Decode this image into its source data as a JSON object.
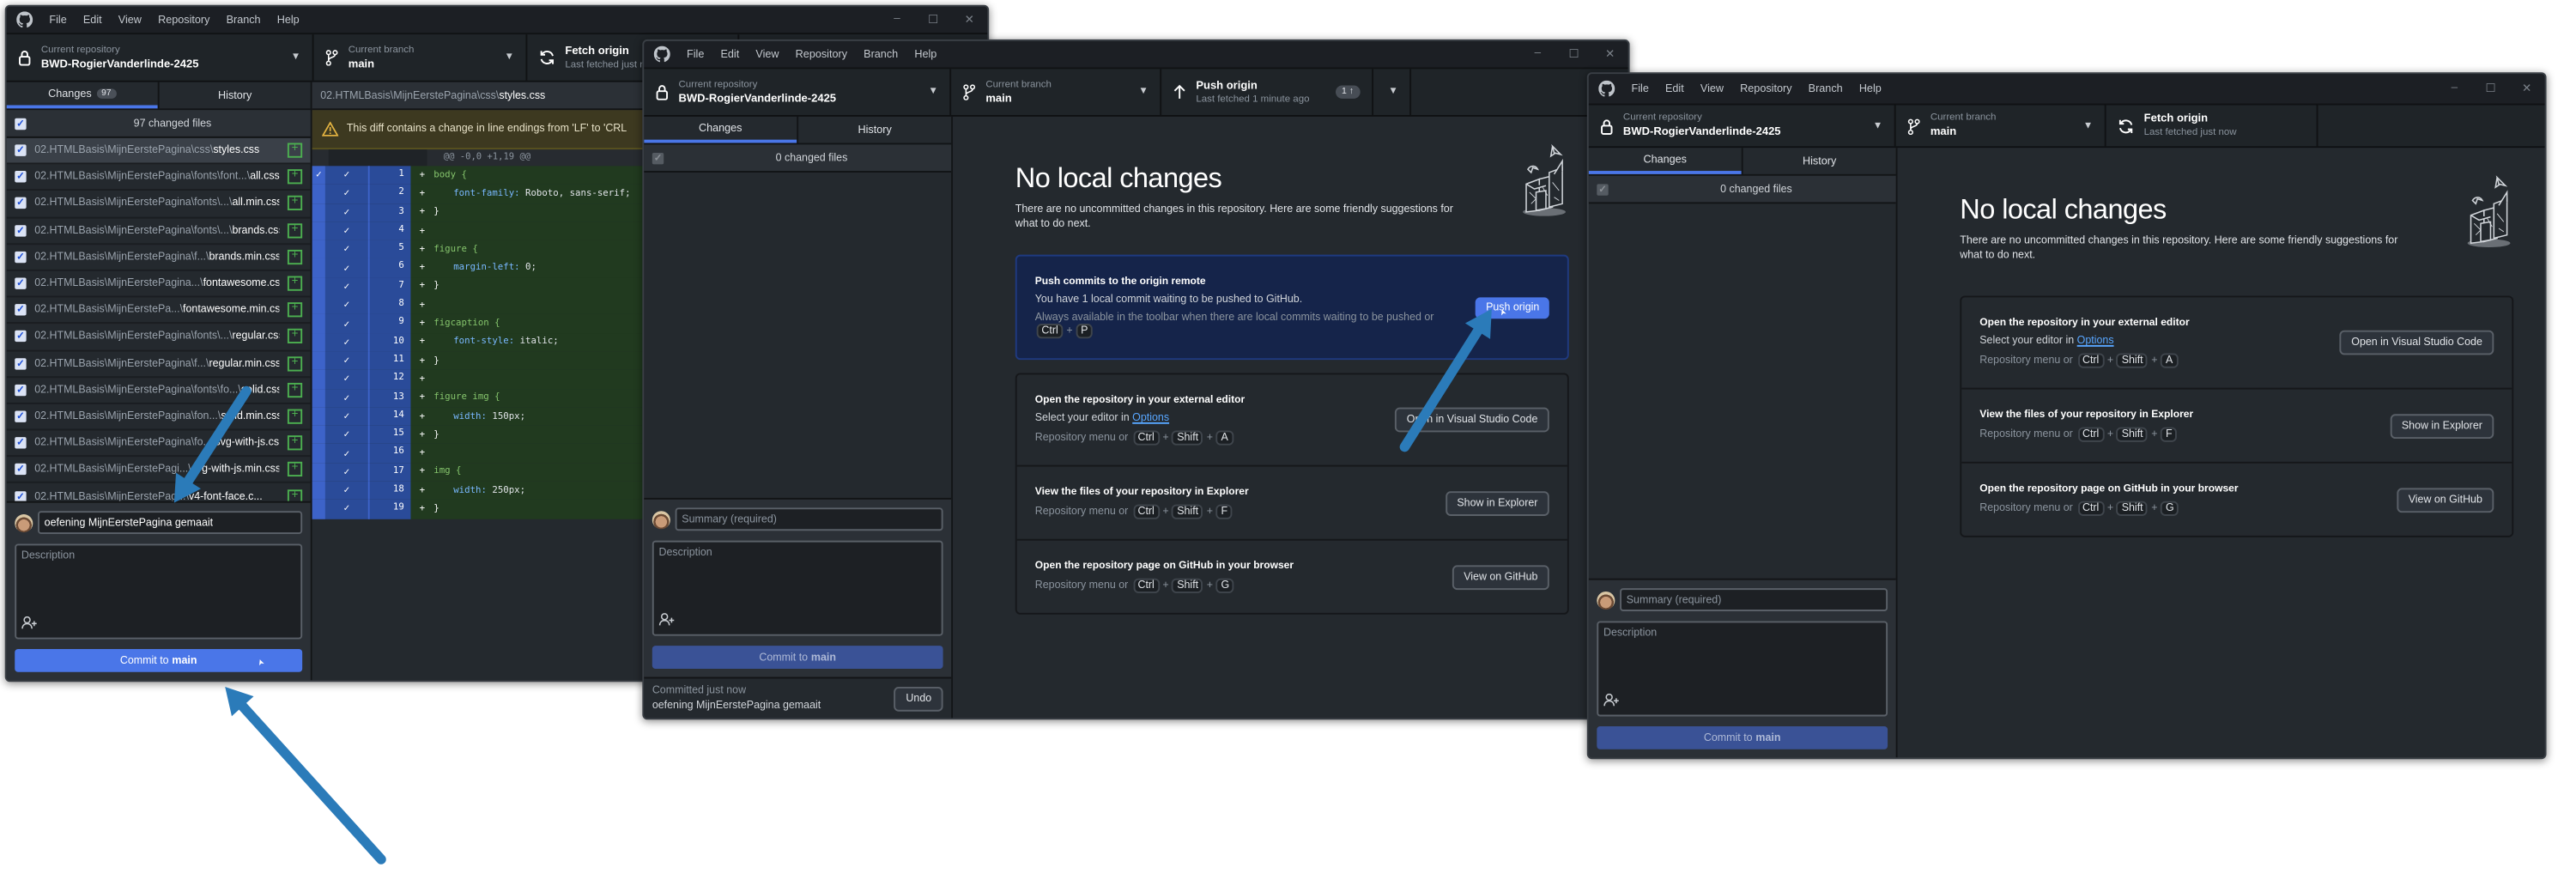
{
  "menu": [
    "File",
    "Edit",
    "View",
    "Repository",
    "Branch",
    "Help"
  ],
  "window_controls": [
    "–",
    "☐",
    "✕"
  ],
  "key_sep": "+",
  "windows": [
    {
      "repo": {
        "label": "Current repository",
        "name": "BWD-RogierVanderlinde-2425"
      },
      "branch": {
        "label": "Current branch",
        "name": "main"
      },
      "action": {
        "title": "Fetch origin",
        "subtitle": "Last fetched just now",
        "icon": "sync-icon"
      },
      "tabs": {
        "changes": "Changes",
        "changes_count": "97",
        "history": "History"
      },
      "changed_files_label": "97 changed files",
      "files": [
        {
          "dir": "02.HTMLBasis\\MijnEerstePagina\\css\\",
          "name": "styles.css"
        },
        {
          "dir": "02.HTMLBasis\\MijnEerstePagina\\fonts\\font...\\",
          "name": "all.css"
        },
        {
          "dir": "02.HTMLBasis\\MijnEerstePagina\\fonts\\...\\",
          "name": "all.min.css"
        },
        {
          "dir": "02.HTMLBasis\\MijnEerstePagina\\fonts\\...\\",
          "name": "brands.css"
        },
        {
          "dir": "02.HTMLBasis\\MijnEerstePagina\\f...\\",
          "name": "brands.min.css"
        },
        {
          "dir": "02.HTMLBasis\\MijnEerstePagina...\\",
          "name": "fontawesome.css"
        },
        {
          "dir": "02.HTMLBasis\\MijnEerstePa...\\",
          "name": "fontawesome.min.css"
        },
        {
          "dir": "02.HTMLBasis\\MijnEerstePagina\\fonts\\...\\",
          "name": "regular.css"
        },
        {
          "dir": "02.HTMLBasis\\MijnEerstePagina\\f...\\",
          "name": "regular.min.css"
        },
        {
          "dir": "02.HTMLBasis\\MijnEerstePagina\\fonts\\fo...\\",
          "name": "solid.css"
        },
        {
          "dir": "02.HTMLBasis\\MijnEerstePagina\\fon...\\",
          "name": "solid.min.css"
        },
        {
          "dir": "02.HTMLBasis\\MijnEerstePagina\\fo...\\",
          "name": "svg-with-js.css"
        },
        {
          "dir": "02.HTMLBasis\\MijnEerstePagi...\\",
          "name": "svg-with-js.min.css"
        },
        {
          "dir": "02.HTMLBasis\\MijnEerstePag...\\",
          "name": "v4-font-face.c..."
        }
      ],
      "diff": {
        "path_dir": "02.HTMLBasis\\MijnEerstePagina\\css\\",
        "path_file": "styles.css",
        "warning": "This diff contains a change in line endings from 'LF' to 'CRL",
        "hunk": "@@ -0,0 +1,19 @@",
        "lines": [
          {
            "n": "1",
            "sel": "body {"
          },
          {
            "n": "2",
            "prop": "font-family:",
            "val": " Roboto, sans-serif;"
          },
          {
            "n": "3",
            "text": "}"
          },
          {
            "n": "4",
            "text": ""
          },
          {
            "n": "5",
            "sel": "figure {"
          },
          {
            "n": "6",
            "prop": "margin-left:",
            "val": " 0;"
          },
          {
            "n": "7",
            "text": "}"
          },
          {
            "n": "8",
            "text": ""
          },
          {
            "n": "9",
            "sel": "figcaption {"
          },
          {
            "n": "10",
            "prop": "font-style:",
            "val": " italic;"
          },
          {
            "n": "11",
            "text": "}"
          },
          {
            "n": "12",
            "text": ""
          },
          {
            "n": "13",
            "sel": "figure img {"
          },
          {
            "n": "14",
            "prop": "width:",
            "val": " 150px;"
          },
          {
            "n": "15",
            "text": "}"
          },
          {
            "n": "16",
            "text": ""
          },
          {
            "n": "17",
            "sel": "img {"
          },
          {
            "n": "18",
            "prop": "width:",
            "val": " 250px;"
          },
          {
            "n": "19",
            "text": "}"
          }
        ],
        "plus": "+",
        "check": "✓"
      },
      "commit": {
        "summary_value": "oefening MijnEerstePagina gemaait",
        "summary_placeholder": "Summary (required)",
        "description_placeholder": "Description",
        "button_prefix": "Commit to",
        "button_branch": "main",
        "enabled": true
      }
    },
    {
      "repo": {
        "label": "Current repository",
        "name": "BWD-RogierVanderlinde-2425"
      },
      "branch": {
        "label": "Current branch",
        "name": "main"
      },
      "action": {
        "title": "Push origin",
        "subtitle": "Last fetched 1 minute ago",
        "icon": "arrow-up-icon",
        "badge": "1 ↑"
      },
      "tabs": {
        "changes": "Changes",
        "history": "History"
      },
      "changed_files_label": "0 changed files",
      "no_changes": {
        "heading": "No local changes",
        "text": "There are no uncommitted changes in this repository. Here are some friendly suggestions for what to do next.",
        "push_card": {
          "title": "Push commits to the origin remote",
          "desc": "You have 1 local commit waiting to be pushed to GitHub.",
          "hint": "Always available in the toolbar when there are local commits waiting to be pushed or",
          "keys": [
            "Ctrl",
            "P"
          ],
          "button": "Push origin"
        },
        "cards": [
          {
            "title": "Open the repository in your external editor",
            "desc_prefix": "Select your editor in ",
            "link": "Options",
            "hint": "Repository menu or",
            "keys": [
              "Ctrl",
              "Shift",
              "A"
            ],
            "button": "Open in Visual Studio Code"
          },
          {
            "title": "View the files of your repository in Explorer",
            "hint": "Repository menu or",
            "keys": [
              "Ctrl",
              "Shift",
              "F"
            ],
            "button": "Show in Explorer"
          },
          {
            "title": "Open the repository page on GitHub in your browser",
            "hint": "Repository menu or",
            "keys": [
              "Ctrl",
              "Shift",
              "G"
            ],
            "button": "View on GitHub"
          }
        ]
      },
      "commit": {
        "summary_placeholder": "Summary (required)",
        "description_placeholder": "Description",
        "button_prefix": "Commit to",
        "button_branch": "main",
        "enabled": false
      },
      "last_commit": {
        "label": "Committed just now",
        "message": "oefening MijnEerstePagina gemaait",
        "undo": "Undo"
      }
    },
    {
      "repo": {
        "label": "Current repository",
        "name": "BWD-RogierVanderlinde-2425"
      },
      "branch": {
        "label": "Current branch",
        "name": "main"
      },
      "action": {
        "title": "Fetch origin",
        "subtitle": "Last fetched just now",
        "icon": "sync-icon"
      },
      "tabs": {
        "changes": "Changes",
        "history": "History"
      },
      "changed_files_label": "0 changed files",
      "no_changes": {
        "heading": "No local changes",
        "text": "There are no uncommitted changes in this repository. Here are some friendly suggestions for what to do next.",
        "cards": [
          {
            "title": "Open the repository in your external editor",
            "desc_prefix": "Select your editor in ",
            "link": "Options",
            "hint": "Repository menu or",
            "keys": [
              "Ctrl",
              "Shift",
              "A"
            ],
            "button": "Open in Visual Studio Code"
          },
          {
            "title": "View the files of your repository in Explorer",
            "hint": "Repository menu or",
            "keys": [
              "Ctrl",
              "Shift",
              "F"
            ],
            "button": "Show in Explorer"
          },
          {
            "title": "Open the repository page on GitHub in your browser",
            "hint": "Repository menu or",
            "keys": [
              "Ctrl",
              "Shift",
              "G"
            ],
            "button": "View on GitHub"
          }
        ]
      },
      "commit": {
        "summary_placeholder": "Summary (required)",
        "description_placeholder": "Description",
        "button_prefix": "Commit to",
        "button_branch": "main",
        "enabled": false
      }
    }
  ],
  "colors": {
    "accent": "#4a76e8",
    "annotation_arrow": "#2b7bb9",
    "diff_added": "#213a1f",
    "push_card": "#15244a"
  }
}
